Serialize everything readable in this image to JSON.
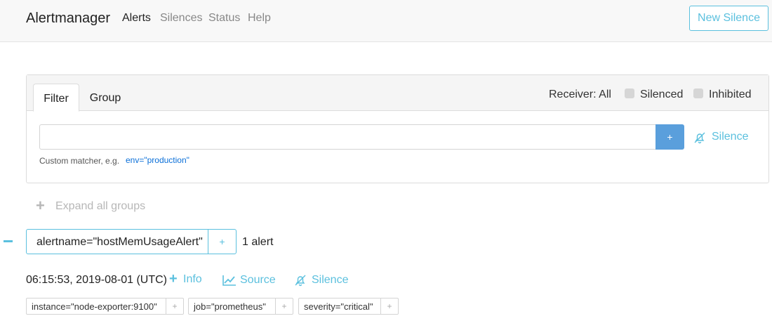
{
  "navbar": {
    "brand": "Alertmanager",
    "links": [
      "Alerts",
      "Silences",
      "Status",
      "Help"
    ],
    "active_link": "Alerts",
    "new_silence_label": "New Silence"
  },
  "filter_panel": {
    "tabs": [
      "Filter",
      "Group"
    ],
    "active_tab": "Filter",
    "receiver_label": "Receiver: All",
    "silenced_label": "Silenced",
    "inhibited_label": "Inhibited",
    "silenced_checked": false,
    "inhibited_checked": false,
    "input_value": "",
    "input_placeholder": "",
    "add_label": "+",
    "silence_label": "Silence",
    "help_text": "Custom matcher, e.g.",
    "help_example": "env=\"production\""
  },
  "expand_all": {
    "icon": "+",
    "label": "Expand all groups"
  },
  "groups": [
    {
      "collapse_icon": "minus-icon",
      "label": "alertname=\"hostMemUsageAlert\"",
      "add_label": "+",
      "count_text": "1 alert",
      "alerts": [
        {
          "time": "06:15:53, 2019-08-01 (UTC)",
          "info_icon": "+",
          "info_label": "Info",
          "source_label": "Source",
          "silence_label": "Silence",
          "labels": [
            {
              "text": "instance=\"node-exporter:9100\"",
              "add": "+"
            },
            {
              "text": "job=\"prometheus\"",
              "add": "+"
            },
            {
              "text": "severity=\"critical\"",
              "add": "+"
            }
          ]
        }
      ]
    }
  ],
  "colors": {
    "accent": "#5bc0de",
    "primary_button": "#5a9fdc",
    "link_blue": "#0a6fd8",
    "muted": "#b7b7b7"
  }
}
